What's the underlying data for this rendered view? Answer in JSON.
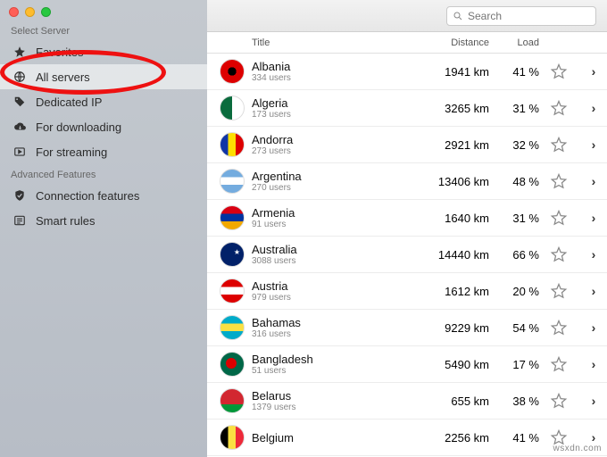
{
  "search": {
    "placeholder": "Search"
  },
  "sidebar": {
    "section1_title": "Select Server",
    "items1": [
      {
        "label": "Favorites"
      },
      {
        "label": "All servers"
      },
      {
        "label": "Dedicated IP"
      },
      {
        "label": "For downloading"
      },
      {
        "label": "For streaming"
      }
    ],
    "section2_title": "Advanced Features",
    "items2": [
      {
        "label": "Connection features"
      },
      {
        "label": "Smart rules"
      }
    ]
  },
  "table": {
    "headers": {
      "title": "Title",
      "distance": "Distance",
      "load": "Load"
    },
    "rows": [
      {
        "flag": "fl-al",
        "name": "Albania",
        "users": "334 users",
        "distance": "1941 km",
        "load": "41 %"
      },
      {
        "flag": "fl-dz",
        "name": "Algeria",
        "users": "173 users",
        "distance": "3265 km",
        "load": "31 %"
      },
      {
        "flag": "fl-ad",
        "name": "Andorra",
        "users": "273 users",
        "distance": "2921 km",
        "load": "32 %"
      },
      {
        "flag": "fl-ar",
        "name": "Argentina",
        "users": "270 users",
        "distance": "13406 km",
        "load": "48 %"
      },
      {
        "flag": "fl-am",
        "name": "Armenia",
        "users": "91 users",
        "distance": "1640 km",
        "load": "31 %"
      },
      {
        "flag": "fl-au",
        "name": "Australia",
        "users": "3088 users",
        "distance": "14440 km",
        "load": "66 %"
      },
      {
        "flag": "fl-at",
        "name": "Austria",
        "users": "979 users",
        "distance": "1612 km",
        "load": "20 %"
      },
      {
        "flag": "fl-bs",
        "name": "Bahamas",
        "users": "316 users",
        "distance": "9229 km",
        "load": "54 %"
      },
      {
        "flag": "fl-bd",
        "name": "Bangladesh",
        "users": "51 users",
        "distance": "5490 km",
        "load": "17 %"
      },
      {
        "flag": "fl-by",
        "name": "Belarus",
        "users": "1379 users",
        "distance": "655 km",
        "load": "38 %"
      },
      {
        "flag": "fl-be",
        "name": "Belgium",
        "users": "",
        "distance": "2256 km",
        "load": "41 %"
      }
    ]
  },
  "watermark": "wsxdn.com"
}
